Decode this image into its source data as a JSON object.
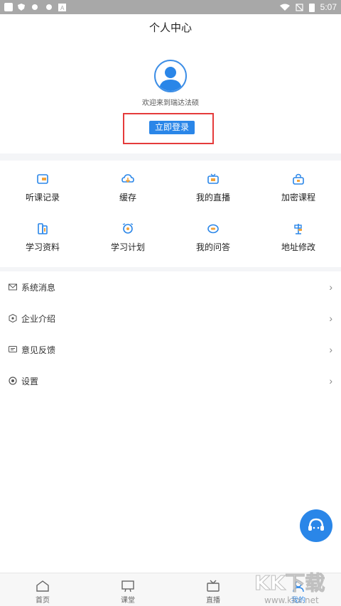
{
  "status_bar": {
    "time": "5:07"
  },
  "header": {
    "title": "个人中心",
    "welcome": "欢迎来到瑞达法硕",
    "login_label": "立即登录"
  },
  "grid": [
    {
      "label": "听课记录",
      "icon": "record-icon"
    },
    {
      "label": "缓存",
      "icon": "cache-icon"
    },
    {
      "label": "我的直播",
      "icon": "live-icon"
    },
    {
      "label": "加密课程",
      "icon": "lock-course-icon"
    },
    {
      "label": "学习资料",
      "icon": "materials-icon"
    },
    {
      "label": "学习计划",
      "icon": "plan-icon"
    },
    {
      "label": "我的问答",
      "icon": "qa-icon"
    },
    {
      "label": "地址修改",
      "icon": "address-icon"
    }
  ],
  "menu": [
    {
      "label": "系统消息",
      "icon": "mail-icon"
    },
    {
      "label": "企业介绍",
      "icon": "company-icon"
    },
    {
      "label": "意见反馈",
      "icon": "feedback-icon"
    },
    {
      "label": "设置",
      "icon": "settings-icon"
    }
  ],
  "bottom_nav": [
    {
      "label": "首页",
      "icon": "home-icon"
    },
    {
      "label": "课堂",
      "icon": "classroom-icon"
    },
    {
      "label": "直播",
      "icon": "tv-icon"
    },
    {
      "label": "我的",
      "icon": "profile-icon",
      "active": true
    }
  ],
  "watermark": "KK下载",
  "watermark_url": "www.kkx.net",
  "colors": {
    "accent": "#2a86e8",
    "highlight_border": "#e53b3b",
    "icon_orange": "#f2a33a"
  }
}
